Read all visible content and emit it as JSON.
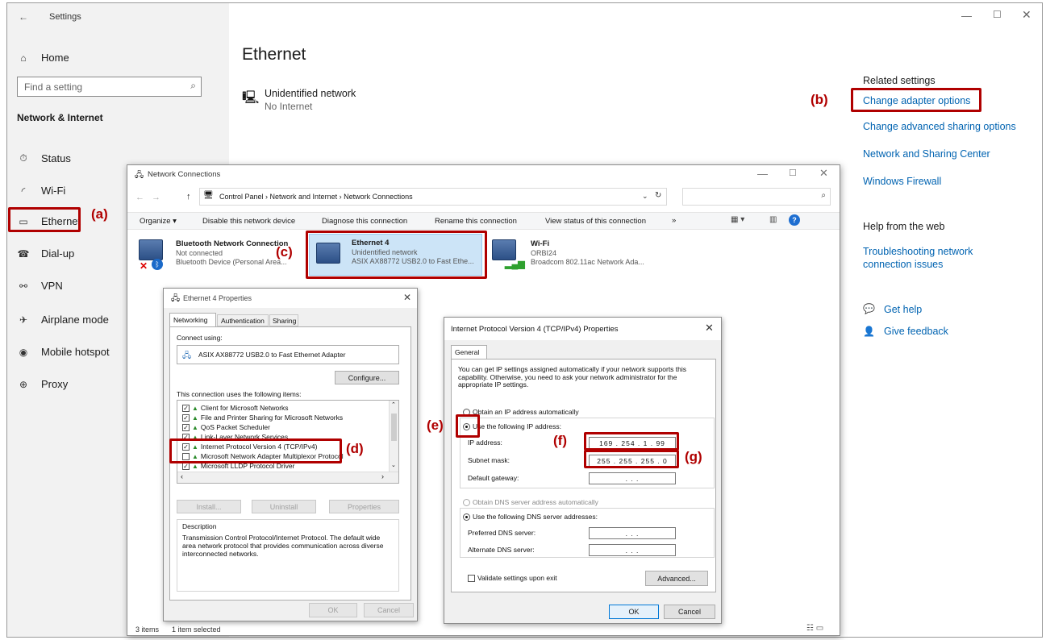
{
  "settings": {
    "title": "Settings",
    "home": "Home",
    "search_placeholder": "Find a setting",
    "section": "Network & Internet",
    "nav": [
      {
        "label": "Status",
        "icon": "status-icon",
        "glyph": "⏱"
      },
      {
        "label": "Wi-Fi",
        "icon": "wifi-icon",
        "glyph": "◜"
      },
      {
        "label": "Ethernet",
        "icon": "ethernet-icon",
        "glyph": "▭"
      },
      {
        "label": "Dial-up",
        "icon": "dialup-icon",
        "glyph": "☎"
      },
      {
        "label": "VPN",
        "icon": "vpn-icon",
        "glyph": "⚯"
      },
      {
        "label": "Airplane mode",
        "icon": "airplane-icon",
        "glyph": "✈"
      },
      {
        "label": "Mobile hotspot",
        "icon": "hotspot-icon",
        "glyph": "◉"
      },
      {
        "label": "Proxy",
        "icon": "globe-icon",
        "glyph": "⊕"
      }
    ],
    "page_title": "Ethernet",
    "network_name": "Unidentified network",
    "network_status": "No Internet",
    "related_heading": "Related settings",
    "related_links": [
      "Change adapter options",
      "Change advanced sharing options",
      "Network and Sharing Center",
      "Windows Firewall"
    ],
    "help_heading": "Help from the web",
    "help_link": "Troubleshooting network connection issues",
    "get_help": "Get help",
    "give_feedback": "Give feedback"
  },
  "netconn": {
    "title": "Network Connections",
    "breadcrumb": "Control Panel  ›  Network and Internet  ›  Network Connections",
    "toolbar": [
      "Organize ▾",
      "Disable this network device",
      "Diagnose this connection",
      "Rename this connection",
      "View status of this connection",
      "»"
    ],
    "adapters": [
      {
        "name": "Bluetooth Network Connection",
        "status": "Not connected",
        "device": "Bluetooth Device (Personal Area..."
      },
      {
        "name": "Ethernet 4",
        "status": "Unidentified network",
        "device": "ASIX AX88772 USB2.0 to Fast Ethe..."
      },
      {
        "name": "Wi-Fi",
        "status": "ORBI24",
        "device": "Broadcom 802.11ac Network Ada..."
      }
    ],
    "status_items": "3 items",
    "status_selected": "1 item selected"
  },
  "props": {
    "title": "Ethernet 4 Properties",
    "tabs": [
      "Networking",
      "Authentication",
      "Sharing"
    ],
    "connect_using": "Connect using:",
    "adapter": "ASIX AX88772 USB2.0 to Fast Ethernet Adapter",
    "configure": "Configure...",
    "items_label": "This connection uses the following items:",
    "items": [
      "Client for Microsoft Networks",
      "File and Printer Sharing for Microsoft Networks",
      "QoS Packet Scheduler",
      "Link-Layer Network Services",
      "Internet Protocol Version 4 (TCP/IPv4)",
      "Microsoft Network Adapter Multiplexor Protocol",
      "Microsoft LLDP Protocol Driver"
    ],
    "install": "Install...",
    "uninstall": "Uninstall",
    "properties": "Properties",
    "description_label": "Description",
    "description": "Transmission Control Protocol/Internet Protocol. The default wide area network protocol that provides communication across diverse interconnected networks.",
    "ok": "OK",
    "cancel": "Cancel"
  },
  "ipv4": {
    "title": "Internet Protocol Version 4 (TCP/IPv4) Properties",
    "tab": "General",
    "intro": "You can get IP settings assigned automatically if your network supports this capability. Otherwise, you need to ask your network administrator for the appropriate IP settings.",
    "auto_ip": "Obtain an IP address automatically",
    "manual_ip": "Use the following IP address:",
    "ip_label": "IP address:",
    "ip_value": "169 . 254 .  1  . 99",
    "mask_label": "Subnet mask:",
    "mask_value": "255 . 255 . 255 .  0",
    "gateway_label": "Default gateway:",
    "empty_ip": ".       .       .",
    "auto_dns": "Obtain DNS server address automatically",
    "manual_dns": "Use the following DNS server addresses:",
    "pref_dns": "Preferred DNS server:",
    "alt_dns": "Alternate DNS server:",
    "validate": "Validate settings upon exit",
    "advanced": "Advanced...",
    "ok": "OK",
    "cancel": "Cancel"
  },
  "annotations": {
    "a": "(a)",
    "b": "(b)",
    "c": "(c)",
    "d": "(d)",
    "e": "(e)",
    "f": "(f)",
    "g": "(g)"
  },
  "colors": {
    "annotation": "#b00000",
    "link": "#0063b1"
  }
}
